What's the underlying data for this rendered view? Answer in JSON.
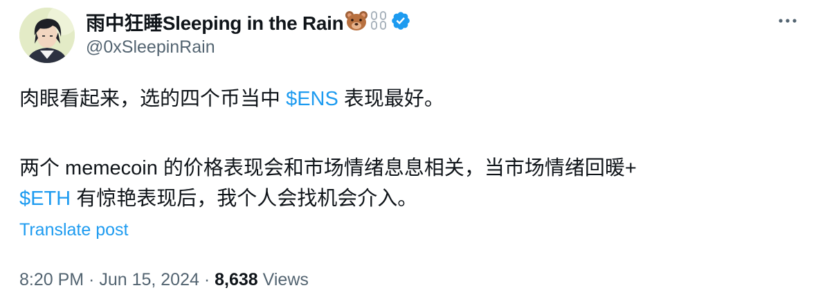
{
  "author": {
    "display_name": "雨中狂睡Sleeping in the Rain",
    "handle": "@0xSleepinRain",
    "emojis": [
      "bear-emoji",
      "chain-emoji"
    ],
    "verified_color": "#1d9bf0"
  },
  "tweet": {
    "p1_text_a": "肉眼看起来，选的四个币当中 ",
    "p1_cashtag": "$ENS",
    "p1_text_b": " 表现最好。",
    "p2_line1": "两个 memecoin 的价格表现会和市场情绪息息相关，当市场情绪回暖+",
    "p2_cashtag": "$ETH",
    "p2_text_b": " 有惊艳表现后，我个人会找机会介入。"
  },
  "translate_label": "Translate post",
  "meta": {
    "time": "8:20 PM",
    "sep1": " · ",
    "date": "Jun 15, 2024",
    "sep2": " · ",
    "views_count": "8,638",
    "views_label": " Views"
  },
  "colors": {
    "accent": "#1d9bf0",
    "text": "#0f1419",
    "secondary": "#536471"
  }
}
